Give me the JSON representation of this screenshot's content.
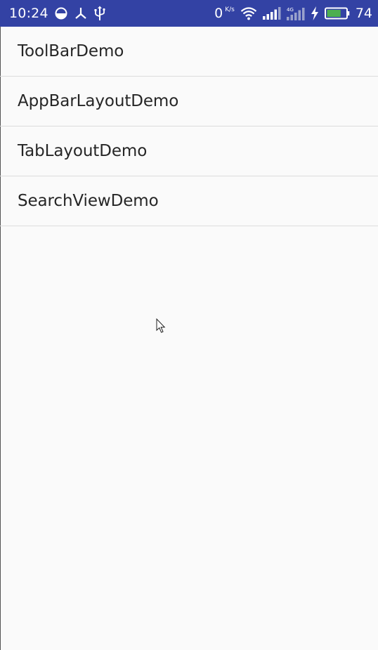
{
  "status_bar": {
    "time": "10:24",
    "network_speed_value": "0",
    "network_speed_unit": "K/s",
    "battery_level": "74",
    "background_color": "#3342a4",
    "battery_fill_color": "#4caf50",
    "icons_left": [
      "data-saver-icon",
      "usb-debug-icon",
      "usb-icon"
    ],
    "icons_right": [
      "wifi-icon",
      "signal-icon",
      "signal-4g-icon",
      "charging-bolt-icon",
      "battery-icon"
    ]
  },
  "list": {
    "items": [
      {
        "label": "ToolBarDemo"
      },
      {
        "label": "AppBarLayoutDemo"
      },
      {
        "label": "TabLayoutDemo"
      },
      {
        "label": "SearchViewDemo"
      }
    ]
  },
  "colors": {
    "background": "#fafafa",
    "divider": "#dcdcdc",
    "text": "#262626"
  }
}
